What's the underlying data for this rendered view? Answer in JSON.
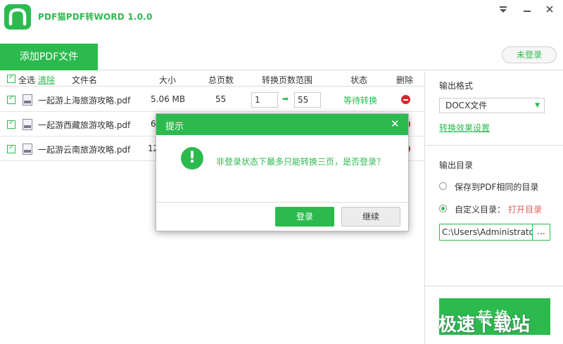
{
  "window": {
    "title": "PDF猫PDF转WORD 1.0.0",
    "menu_icon": "menu-down-icon",
    "minimize_icon": "minimize-icon",
    "close_icon": "close-icon"
  },
  "toolbar": {
    "add_pdf_label": "添加PDF文件",
    "login_status": "未登录"
  },
  "table": {
    "headers": {
      "select_all": "全选",
      "clear": "清除",
      "filename": "文件名",
      "size": "大小",
      "total_pages": "总页数",
      "page_range": "转换页数范围",
      "status": "状态",
      "delete": "删除"
    },
    "rows": [
      {
        "filename": "一起游上海旅游攻略.pdf",
        "size": "5.06 MB",
        "pages": "55",
        "from": "1",
        "to": "55",
        "status": "等待转换"
      },
      {
        "filename": "一起游西藏旅游攻略.pdf",
        "size": "6",
        "pages": "",
        "from": "",
        "to": "",
        "status": ""
      },
      {
        "filename": "一起游云南旅游攻略.pdf",
        "size": "12",
        "pages": "",
        "from": "",
        "to": "",
        "status": ""
      }
    ]
  },
  "right_panel": {
    "output_format_label": "输出格式",
    "format_value": "DOCX文件",
    "effect_settings_link": "转换效果设置",
    "output_dir_label": "输出目录",
    "option_same_dir": "保存到PDF相同的目录",
    "option_custom_dir": "自定义目录：",
    "open_dir_link": "打开目录",
    "path_value": "C:\\Users\\Administrator",
    "browse_label": "...",
    "convert_label": "转换",
    "watermark": "极速下载站"
  },
  "dialog": {
    "title": "提示",
    "message": "非登录状态下最多只能转换三页，是否登录？",
    "login_button": "登录",
    "continue_button": "继续"
  },
  "colors": {
    "accent": "#2cba4e",
    "danger": "#d8262c"
  }
}
